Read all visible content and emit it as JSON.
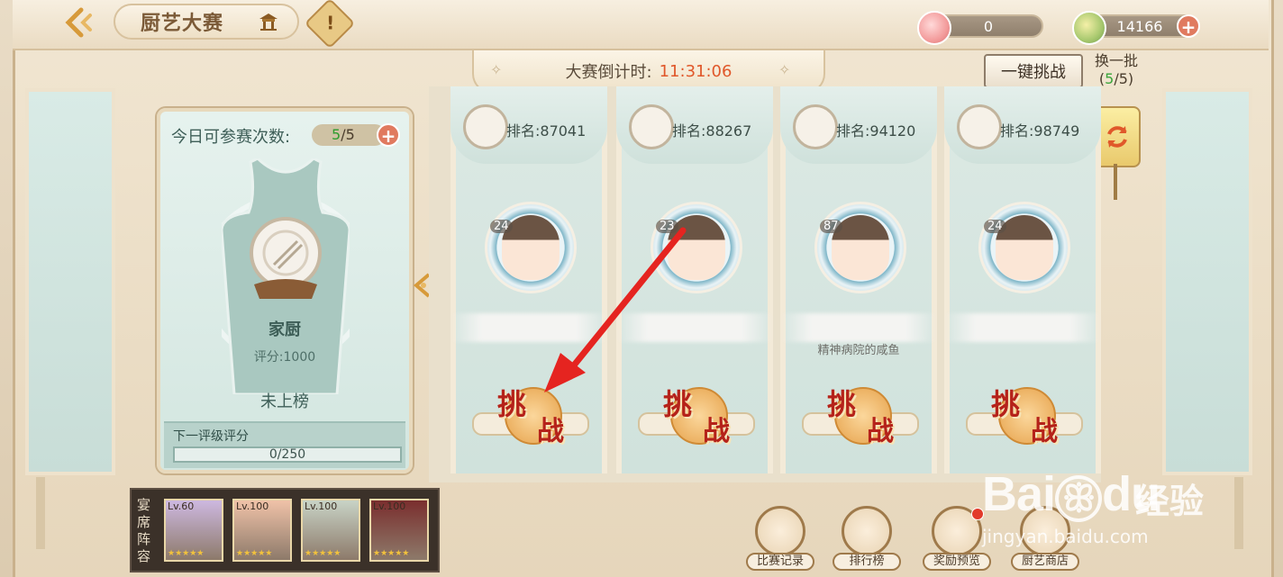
{
  "header": {
    "title": "厨艺大赛",
    "alert_symbol": "!",
    "peach_count": "0",
    "coin_count": "14166",
    "plus_symbol": "+"
  },
  "countdown": {
    "label": "大赛倒计时:",
    "time": "11:31:06"
  },
  "actions": {
    "one_click_challenge": "一键挑战",
    "refresh_label": "换一批",
    "refresh_open": "(",
    "refresh_used": "5",
    "refresh_rest": "/5)"
  },
  "player": {
    "attempts_label": "今日可参赛次数:",
    "attempts_current": "5",
    "attempts_rest": "/5",
    "name": "家厨",
    "score": "评分:1000",
    "rank_status": "未上榜",
    "next_label": "下一评级评分",
    "next_progress": "0/250",
    "next_progress_fraction": 0
  },
  "opponents": [
    {
      "rank": "排名:87041",
      "level": "24",
      "subtitle": "",
      "challenge_t1": "挑",
      "challenge_t2": "战"
    },
    {
      "rank": "排名:88267",
      "level": "23",
      "subtitle": "",
      "challenge_t1": "挑",
      "challenge_t2": "战"
    },
    {
      "rank": "排名:94120",
      "level": "87",
      "subtitle": "精神病院的咸鱼",
      "challenge_t1": "挑",
      "challenge_t2": "战"
    },
    {
      "rank": "排名:98749",
      "level": "24",
      "subtitle": "",
      "challenge_t1": "挑",
      "challenge_t2": "战"
    }
  ],
  "lineup": {
    "label": "宴席阵容",
    "heroes": [
      {
        "level": "Lv.60",
        "stars": "★★★★★",
        "color": "#cdb8e0"
      },
      {
        "level": "Lv.100",
        "stars": "★★★★★",
        "color": "#f0c2a8"
      },
      {
        "level": "Lv.100",
        "stars": "★★★★★",
        "color": "#c8d3c6"
      },
      {
        "level": "Lv.100",
        "stars": "★★★★★",
        "color": "#7a2e2e"
      }
    ]
  },
  "bottom_nav": [
    {
      "label": "比赛记录",
      "icon": "vs-record-icon"
    },
    {
      "label": "排行榜",
      "icon": "podium-icon"
    },
    {
      "label": "奖励预览",
      "icon": "reward-preview-icon"
    },
    {
      "label": "厨艺商店",
      "icon": "shop-icon"
    }
  ],
  "watermark": {
    "brand": "Bai",
    "brand2": "du",
    "cn": "经验",
    "url": "jingyan.baidu.com"
  },
  "colors": {
    "accent_red": "#b5221a",
    "timer_orange": "#e0572a",
    "teal_panel": "#d3e6e0",
    "arrow_red": "#e52420"
  }
}
